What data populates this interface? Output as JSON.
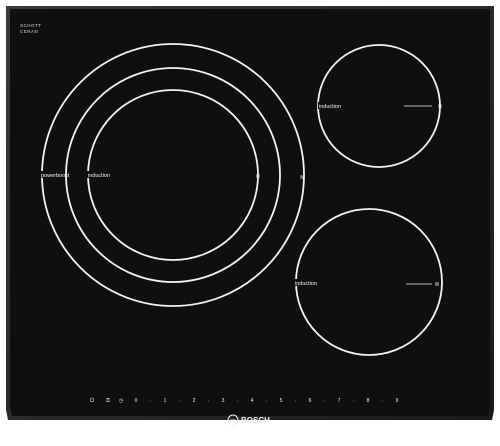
{
  "brand_logo": {
    "line1": "SCHOTT",
    "line2": "CERAN",
    "line3": ""
  },
  "zones": {
    "large": {
      "outer_label": "powerboost",
      "inner_label": "induction"
    },
    "top_right": {
      "label": "induction"
    },
    "bottom_right": {
      "label": "induction"
    }
  },
  "control_panel": {
    "top_buttons": [
      "",
      ""
    ],
    "power_levels": [
      "0",
      "1",
      "2",
      "3",
      "4",
      "5",
      "6",
      "7",
      "8",
      "9"
    ],
    "extra_label": ""
  },
  "brand": {
    "name": "BOSCH"
  },
  "colors": {
    "glass": "#0f0f0f",
    "glass_edge": "#2b2b2b",
    "print": "#f2f2f2"
  }
}
